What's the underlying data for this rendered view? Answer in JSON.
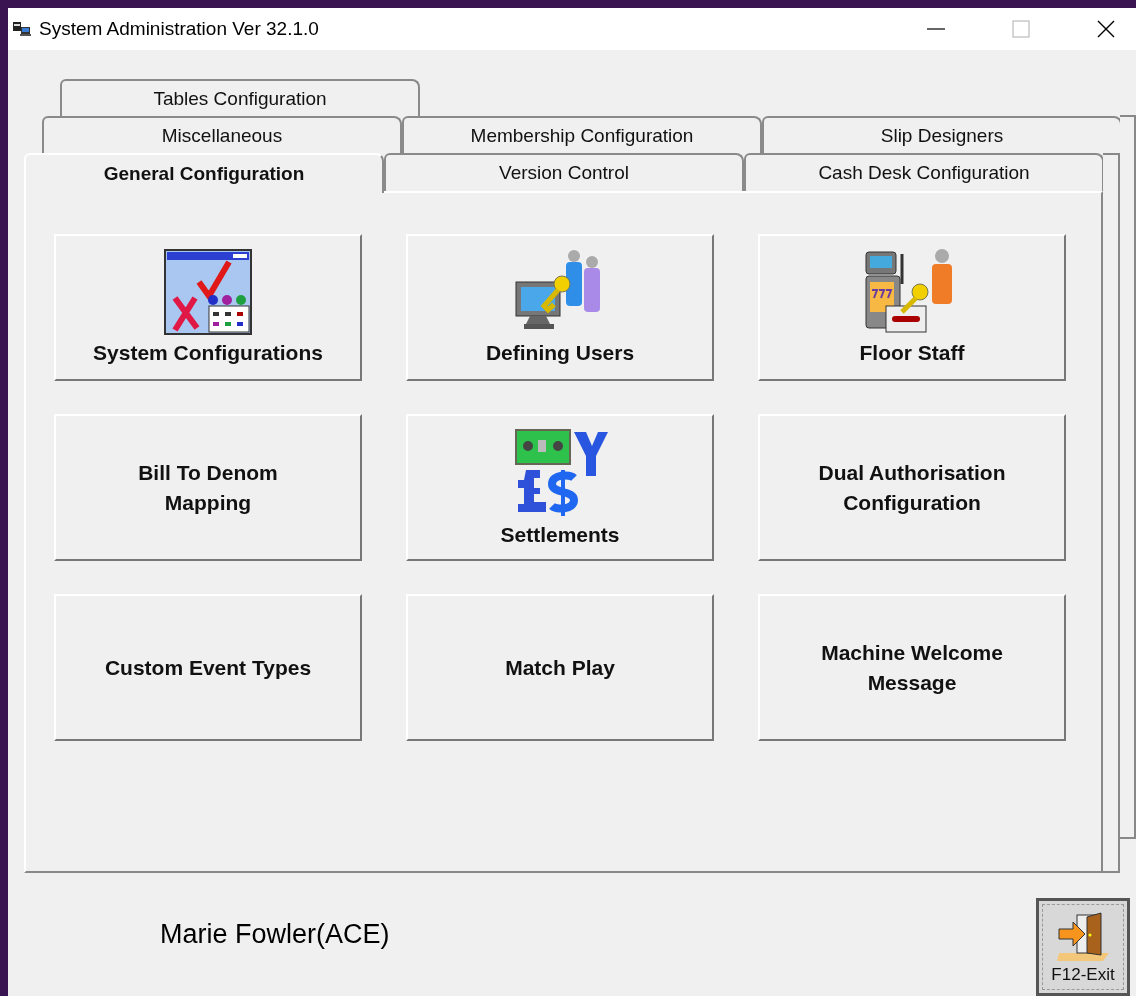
{
  "window": {
    "title": "System Administration Ver 32.1.0"
  },
  "tab_rows": [
    {
      "tabs": [
        {
          "label": "Tables Configuration",
          "selected": false
        }
      ]
    },
    {
      "tabs": [
        {
          "label": "Miscellaneous",
          "selected": false
        },
        {
          "label": "Membership Configuration",
          "selected": false
        },
        {
          "label": "Slip Designers",
          "selected": false
        }
      ]
    },
    {
      "tabs": [
        {
          "label": "General Configuration",
          "selected": true
        },
        {
          "label": "Version Control",
          "selected": false
        },
        {
          "label": "Cash Desk Configuration",
          "selected": false
        }
      ]
    }
  ],
  "buttons": [
    {
      "label": "System Configurations",
      "kind": "config"
    },
    {
      "label": "Defining Users",
      "kind": "users"
    },
    {
      "label": "Floor Staff",
      "kind": "staff"
    },
    {
      "label": "Bill To Denom\nMapping",
      "kind": "text"
    },
    {
      "label": "Settlements",
      "kind": "currency"
    },
    {
      "label": "Dual Authorisation\nConfiguration",
      "kind": "text"
    },
    {
      "label": "Custom Event Types",
      "kind": "text"
    },
    {
      "label": "Match Play",
      "kind": "text"
    },
    {
      "label": "Machine Welcome\nMessage",
      "kind": "text"
    }
  ],
  "user": "Marie Fowler(ACE)",
  "exit_button": {
    "label": "F12-Exit"
  }
}
